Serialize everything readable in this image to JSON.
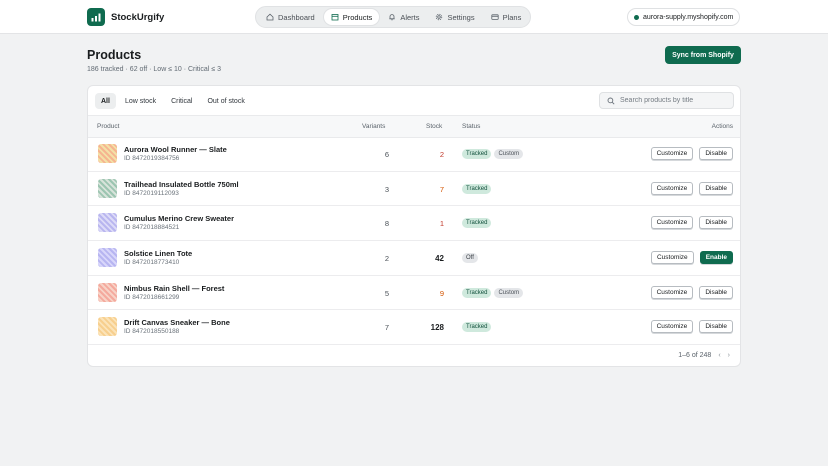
{
  "brand": {
    "name": "StockUrgify",
    "accent": "#0f6b4f"
  },
  "nav": [
    {
      "label": "Dashboard",
      "icon": "home-icon",
      "active": false
    },
    {
      "label": "Products",
      "icon": "box-icon",
      "active": true
    },
    {
      "label": "Alerts",
      "icon": "bell-icon",
      "active": false
    },
    {
      "label": "Settings",
      "icon": "gear-icon",
      "active": false
    },
    {
      "label": "Plans",
      "icon": "card-icon",
      "active": false
    }
  ],
  "store": {
    "domain": "aurora-supply.myshopify.com"
  },
  "page": {
    "title": "Products",
    "subtitle": "186 tracked · 62 off · Low ≤ 10 · Critical ≤ 3",
    "sync_label": "Sync from Shopify"
  },
  "filters": [
    "All",
    "Low stock",
    "Critical",
    "Out of stock"
  ],
  "search": {
    "placeholder": "Search products by title",
    "value": ""
  },
  "table": {
    "headers": {
      "product": "Product",
      "variants": "Variants",
      "stock": "Stock",
      "status": "Status",
      "actions": "Actions"
    },
    "rows": [
      {
        "name": "Aurora Wool Runner — Slate",
        "id": "ID 8472019384756",
        "variants": "6",
        "stock": "2",
        "level": "low",
        "badges": [
          "Tracked",
          "Custom"
        ],
        "off": false,
        "colors": [
          "#f6b48f",
          "#f3e0a6"
        ]
      },
      {
        "name": "Trailhead Insulated Bottle 750ml",
        "id": "ID 8472019112093",
        "variants": "3",
        "stock": "7",
        "level": "low2",
        "badges": [
          "Tracked"
        ],
        "off": false,
        "colors": [
          "#9cc5b1",
          "#d7e3da"
        ]
      },
      {
        "name": "Cumulus Merino Crew Sweater",
        "id": "ID 8472018884521",
        "variants": "8",
        "stock": "1",
        "level": "low",
        "badges": [
          "Tracked"
        ],
        "off": false,
        "colors": [
          "#b8b5ef",
          "#dcdaf7"
        ]
      },
      {
        "name": "Solstice Linen Tote",
        "id": "ID 8472018773410",
        "variants": "2",
        "stock": "42",
        "level": "ok",
        "badges": [
          "Off"
        ],
        "off": true,
        "colors": [
          "#b7b5f1",
          "#d8d6fa"
        ]
      },
      {
        "name": "Nimbus Rain Shell — Forest",
        "id": "ID 8472018661299",
        "variants": "5",
        "stock": "9",
        "level": "low2",
        "badges": [
          "Tracked",
          "Custom"
        ],
        "off": false,
        "colors": [
          "#f4a99d",
          "#f7d2c6"
        ]
      },
      {
        "name": "Drift Canvas Sneaker — Bone",
        "id": "ID 8472018550188",
        "variants": "7",
        "stock": "128",
        "level": "ok",
        "badges": [
          "Tracked"
        ],
        "off": false,
        "colors": [
          "#f7cf8e",
          "#fbe3b8"
        ]
      }
    ],
    "customize_label": "Customize",
    "disable_label": "Disable",
    "enable_label": "Enable"
  },
  "pager": {
    "text": "1–6 of 248",
    "prev": "‹",
    "next": "›"
  }
}
